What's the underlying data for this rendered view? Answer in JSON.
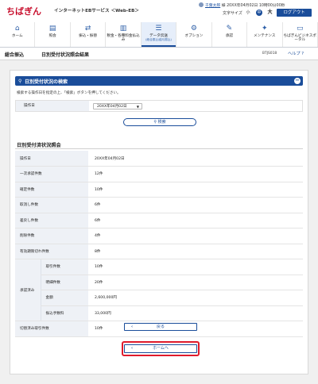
{
  "header": {
    "logo": "ちばぎん",
    "service": "インターネットEBサービス ＜Web-EB＞",
    "user_name": "千葉太郎",
    "user_suffix": "様",
    "last_login": "20XX年04月02日 10時00分00秒",
    "font_size_label": "文字サイズ",
    "font_small": "小",
    "font_medium": "中",
    "font_large": "大",
    "logout": "ログアウト"
  },
  "nav": [
    {
      "label": "ホーム",
      "icon": "home-icon",
      "glyph": "⌂"
    },
    {
      "label": "照会",
      "icon": "inquiry-icon",
      "glyph": "▤"
    },
    {
      "label": "振込・振替",
      "icon": "transfer-icon",
      "glyph": "⇄"
    },
    {
      "label": "税金・各種料金払込み",
      "icon": "tax-icon",
      "glyph": "▥"
    },
    {
      "label": "データ伝送",
      "sub": "(総合振込/給与振込)",
      "icon": "data-transfer-icon",
      "glyph": "☰",
      "active": true
    },
    {
      "label": "オプション",
      "icon": "option-icon",
      "glyph": "⚙"
    },
    {
      "label": "承認",
      "icon": "approval-icon",
      "glyph": "✎"
    },
    {
      "label": "メンテナンス",
      "icon": "maintenance-icon",
      "glyph": "✦"
    },
    {
      "label": "ちばぎんビジネスポータル",
      "icon": "portal-icon",
      "glyph": "▭"
    }
  ],
  "page": {
    "category": "総合振込",
    "title": "日別受付状況照会結果",
    "screen_id": "BTJS018",
    "help": "ヘルプ"
  },
  "search": {
    "title": "日別受付状況の検索",
    "instruction": "検索する操作日を指定の上、「検索」ボタンを押してください。",
    "date_label": "操作日",
    "date_value": "20XX年04月02日",
    "button": "検索"
  },
  "results": {
    "title": "日別受付済状況照会",
    "operation_date_label": "操作日",
    "operation_date": "20XX年04月02日",
    "rows": [
      {
        "label": "一次承認件数",
        "value": "12件"
      },
      {
        "label": "確定件数",
        "value": "10件"
      },
      {
        "label": "取消し件数",
        "value": "6件"
      },
      {
        "label": "差戻し件数",
        "value": "6件"
      },
      {
        "label": "削除件数",
        "value": "4件"
      },
      {
        "label": "有効期限切れ件数",
        "value": "8件"
      }
    ],
    "group_label": "承認済み",
    "group_rows": [
      {
        "label": "取引件数",
        "value": "10件"
      },
      {
        "label": "明細件数",
        "value": "20件"
      },
      {
        "label": "金額",
        "value": "2,600,000円"
      },
      {
        "label": "振込手数料",
        "value": "33,000円"
      }
    ],
    "last_label": "切替済み取引件数",
    "last_value": "10件"
  },
  "buttons": {
    "back": "戻る",
    "home": "ホームへ"
  },
  "colors": {
    "brand": "#c8102e",
    "primary": "#1a4d9a",
    "highlight": "#e01a2b"
  }
}
